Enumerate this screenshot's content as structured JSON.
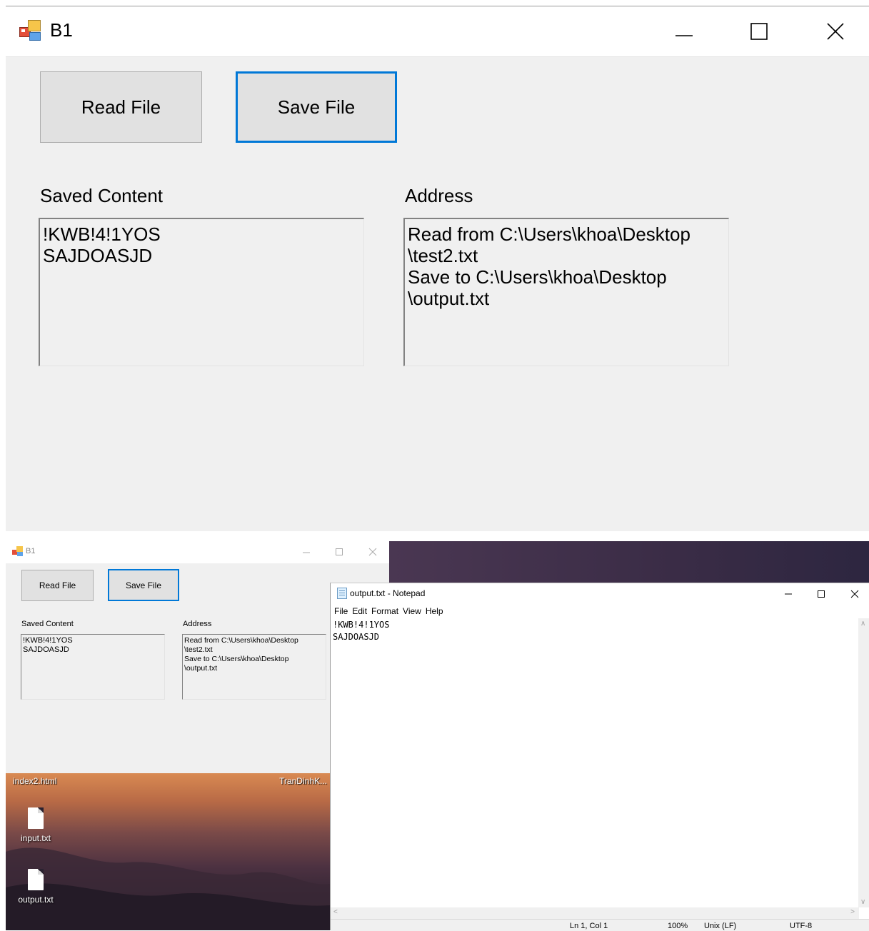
{
  "big_window": {
    "title": "B1",
    "read_button": "Read File",
    "save_button": "Save File",
    "saved_content_label": "Saved Content",
    "saved_content_text": "!KWB!4!1YOS\nSAJDOASJD",
    "address_label": "Address",
    "address_text": "Read from C:\\Users\\khoa\\Desktop\n\\test2.txt\nSave to C:\\Users\\khoa\\Desktop\n\\output.txt"
  },
  "small_window": {
    "title": "B1",
    "read_button": "Read File",
    "save_button": "Save File",
    "saved_content_label": "Saved Content",
    "saved_content_text": "!KWB!4!1YOS\nSAJDOASJD",
    "address_label": "Address",
    "address_text": "Read from C:\\Users\\khoa\\Desktop\n\\test2.txt\nSave to C:\\Users\\khoa\\Desktop\n\\output.txt"
  },
  "desktop": {
    "top_labels": [
      "index2.html",
      "TranDinhK..."
    ],
    "icons": [
      {
        "label": "input.txt",
        "icon": "text-file-icon"
      },
      {
        "label": "output.txt",
        "icon": "text-file-icon"
      }
    ]
  },
  "notepad": {
    "title": "output.txt - Notepad",
    "menu": [
      "File",
      "Edit",
      "Format",
      "View",
      "Help"
    ],
    "content": "!KWB!4!1YOS\nSAJDOASJD",
    "status": {
      "position": "Ln 1, Col 1",
      "zoom": "100%",
      "line_ending": "Unix (LF)",
      "encoding": "UTF-8"
    }
  },
  "colors": {
    "focus_border": "#0078d7",
    "form_background": "#f0f0f0",
    "button_face": "#e1e1e1"
  }
}
